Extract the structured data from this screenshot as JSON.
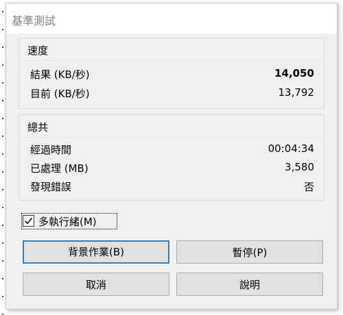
{
  "window": {
    "title": "基準測試"
  },
  "speed": {
    "title": "速度",
    "rows": [
      {
        "label": "結果 (KB/秒)",
        "value": "14,050"
      },
      {
        "label": "目前 (KB/秒)",
        "value": "13,792"
      }
    ]
  },
  "total": {
    "title": "總共",
    "rows": [
      {
        "label": "經過時間",
        "value": "00:04:34"
      },
      {
        "label": "已處理 (MB)",
        "value": "3,580"
      },
      {
        "label": "發現錯誤",
        "value": "否"
      }
    ]
  },
  "multithread": {
    "label": "多執行緒(M)",
    "checked": true
  },
  "buttons": {
    "background": "背景作業(B)",
    "pause": "暫停(P)",
    "cancel": "取消",
    "help": "說明"
  }
}
